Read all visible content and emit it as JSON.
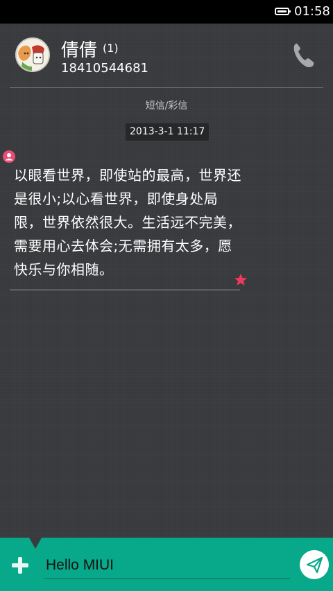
{
  "status_bar": {
    "time": "01:58",
    "battery_icon": "battery-icon"
  },
  "header": {
    "contact_name": "倩倩",
    "unread_count": "(1)",
    "phone_number": "18410544681",
    "call_icon": "phone-icon"
  },
  "conversation": {
    "channel_label": "短信/彩信",
    "timestamp": "2013-3-1 11:17",
    "messages": [
      {
        "text": "以眼看世界，即使站的最高，世界还是很小;以心看世界，即使身处局限，世界依然很大。生活远不完美，需要用心去体会;无需拥有太多，愿快乐与你相随。",
        "starred": true,
        "sender_icon": "person-icon"
      }
    ]
  },
  "composer": {
    "input_value": "Hello MIUI",
    "add_icon": "plus-icon",
    "send_icon": "send-icon",
    "accent_color": "#08a88a"
  }
}
